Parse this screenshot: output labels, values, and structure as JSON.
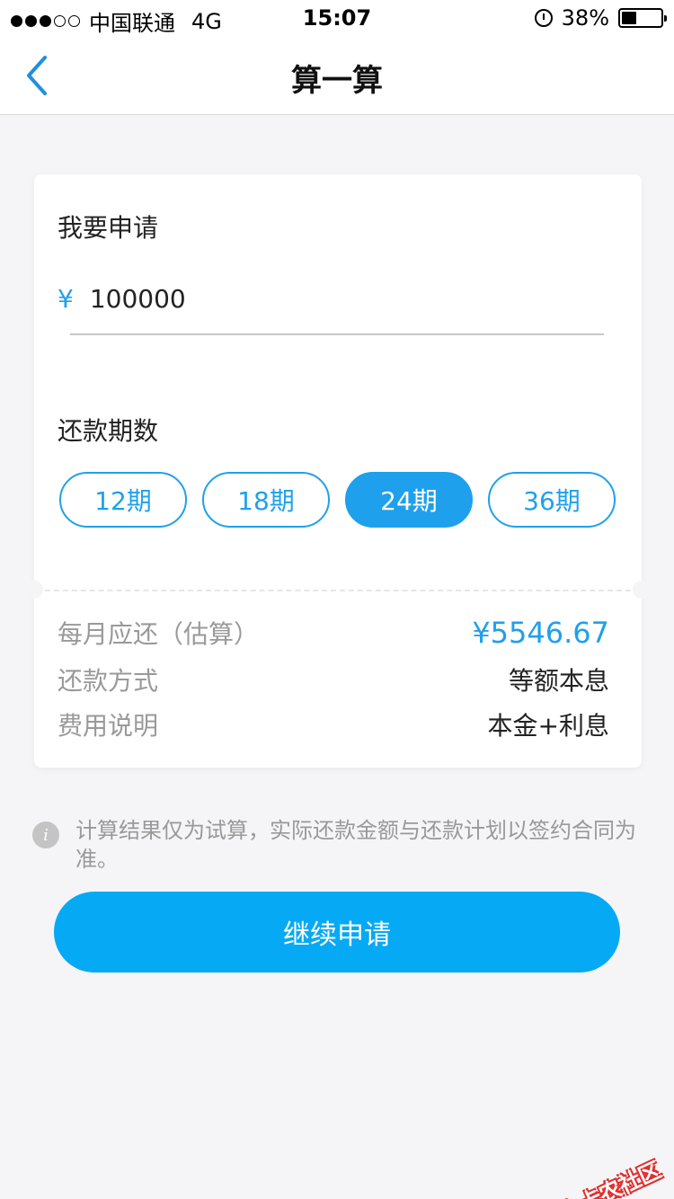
{
  "status_bar": {
    "carrier": "中国联通",
    "network": "4G",
    "time": "15:07",
    "battery": "38%",
    "battery_level": 0.38
  },
  "nav": {
    "title": "算一算"
  },
  "form": {
    "apply_label": "我要申请",
    "currency_symbol": "¥",
    "amount_value": "100000",
    "term_label": "还款期数",
    "terms": [
      "12期",
      "18期",
      "24期",
      "36期"
    ],
    "selected_term": "24期"
  },
  "summary": {
    "monthly_label": "每月应还（估算）",
    "monthly_value": "¥5546.67",
    "method_label": "还款方式",
    "method_value": "等额本息",
    "fee_label": "费用说明",
    "fee_value": "本金+利息"
  },
  "notice": {
    "text": "计算结果仅为试算，实际还款金额与还款计划以签约合同为准。"
  },
  "actions": {
    "continue_label": "继续申请"
  },
  "watermark": {
    "text": "卡农社区"
  },
  "colors": {
    "accent": "#1fa0ec",
    "button": "#06a9f4",
    "background": "#f5f5f7",
    "muted_text": "#999999"
  }
}
